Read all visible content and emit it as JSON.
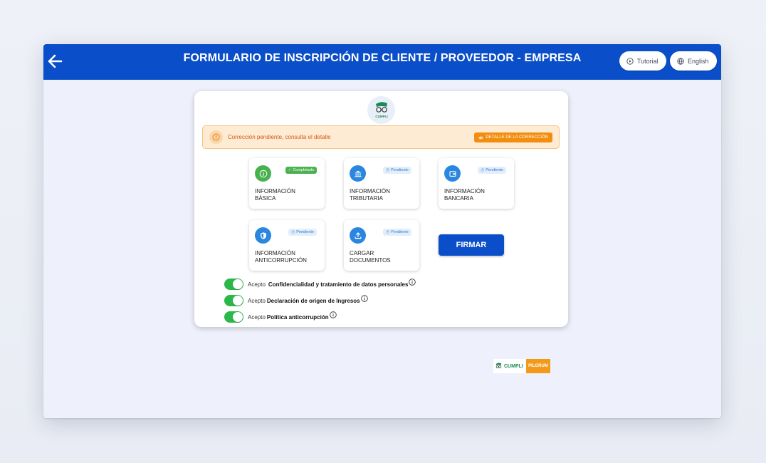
{
  "header": {
    "title": "FORMULARIO DE INSCRIPCIÓN DE CLIENTE / PROVEEDOR - EMPRESA",
    "tutorial_label": "Tutorial",
    "language_label": "English",
    "background_color": "#0a4fc9"
  },
  "logo": {
    "text": "CUMPLI"
  },
  "alert": {
    "message": "Corrección pendiente, consulta el detalle",
    "button_label": "DETALLE DE LA CORRECCIÓN",
    "color": "#f28d0e"
  },
  "sections": [
    {
      "line1": "INFORMACIÓN",
      "line2": "BÁSICA",
      "status": "Completado",
      "icon": "info-icon",
      "color": "#47b14e"
    },
    {
      "line1": "INFORMACIÓN",
      "line2": "TRIBUTARIA",
      "status": "Pendiente",
      "icon": "bank-icon",
      "color": "#2b86e0"
    },
    {
      "line1": "INFORMACIÓN",
      "line2": "BANCARIA",
      "status": "Pendiente",
      "icon": "wallet-icon",
      "color": "#2b86e0"
    },
    {
      "line1": "INFORMACIÓN",
      "line2": "ANTICORRUPCIÓN",
      "status": "Pendiente",
      "icon": "shield-icon",
      "color": "#2b86e0"
    },
    {
      "line1": "CARGAR",
      "line2": "DOCUMENTOS",
      "status": "Pendiente",
      "icon": "upload-icon",
      "color": "#2b86e0"
    }
  ],
  "sign_button_label": "FIRMAR",
  "consents": [
    {
      "lead": "Acepto",
      "strong": "Confidencialidad y tratamiento de datos personales",
      "checked": true
    },
    {
      "lead": "Acepto",
      "strong": "Declaración de origen de Ingresos",
      "checked": true
    },
    {
      "lead": "Acepto",
      "strong": "Política anticorrupción",
      "checked": true
    }
  ],
  "footer": {
    "logo1": "CUMPLI",
    "logo2": "PILGRUM"
  }
}
